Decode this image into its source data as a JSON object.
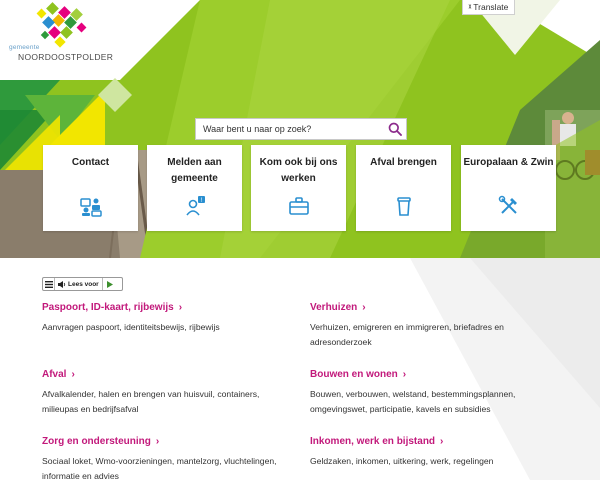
{
  "logo": {
    "small": "gemeente",
    "big": "NOORDOOSTPOLDER"
  },
  "translate": {
    "label": "Translate",
    "icon": "translate-icon"
  },
  "search": {
    "placeholder": "Waar bent u naar op zoek?",
    "icon": "search-icon"
  },
  "colors": {
    "brand_green": "#8fc31f",
    "brand_magenta": "#c2197b",
    "icon_blue": "#2a8fd0",
    "search_icon": "#8c2c8c"
  },
  "tiles": [
    {
      "label": "Contact",
      "icon": "contact-chat-icon"
    },
    {
      "label": "Melden aan gemeente",
      "icon": "person-notification-icon"
    },
    {
      "label": "Kom ook bij ons werken",
      "icon": "briefcase-icon"
    },
    {
      "label": "Afval brengen",
      "icon": "waste-bin-icon"
    },
    {
      "label": "Europalaan & Zwin",
      "icon": "tools-icon"
    }
  ],
  "readspeaker": {
    "label": "Lees voor"
  },
  "categories": [
    {
      "title": "Paspoort, ID-kaart, rijbewijs",
      "desc": "Aanvragen paspoort, identiteitsbewijs, rijbewijs"
    },
    {
      "title": "Verhuizen",
      "desc": "Verhuizen, emigreren en immigreren, briefadres en adresonderzoek"
    },
    {
      "title": "Afval",
      "desc": "Afvalkalender, halen en brengen van huisvuil, containers, milieupas en bedrijfsafval"
    },
    {
      "title": "Bouwen en wonen",
      "desc": "Bouwen, verbouwen, welstand, bestemmingsplannen, omgevingswet, participatie, kavels en subsidies"
    },
    {
      "title": "Zorg en ondersteuning",
      "desc": "Sociaal loket, Wmo-voorzieningen, mantelzorg, vluchtelingen, informatie en advies"
    },
    {
      "title": "Inkomen, werk en bijstand",
      "desc": "Geldzaken, inkomen, uitkering, werk, regelingen"
    }
  ]
}
